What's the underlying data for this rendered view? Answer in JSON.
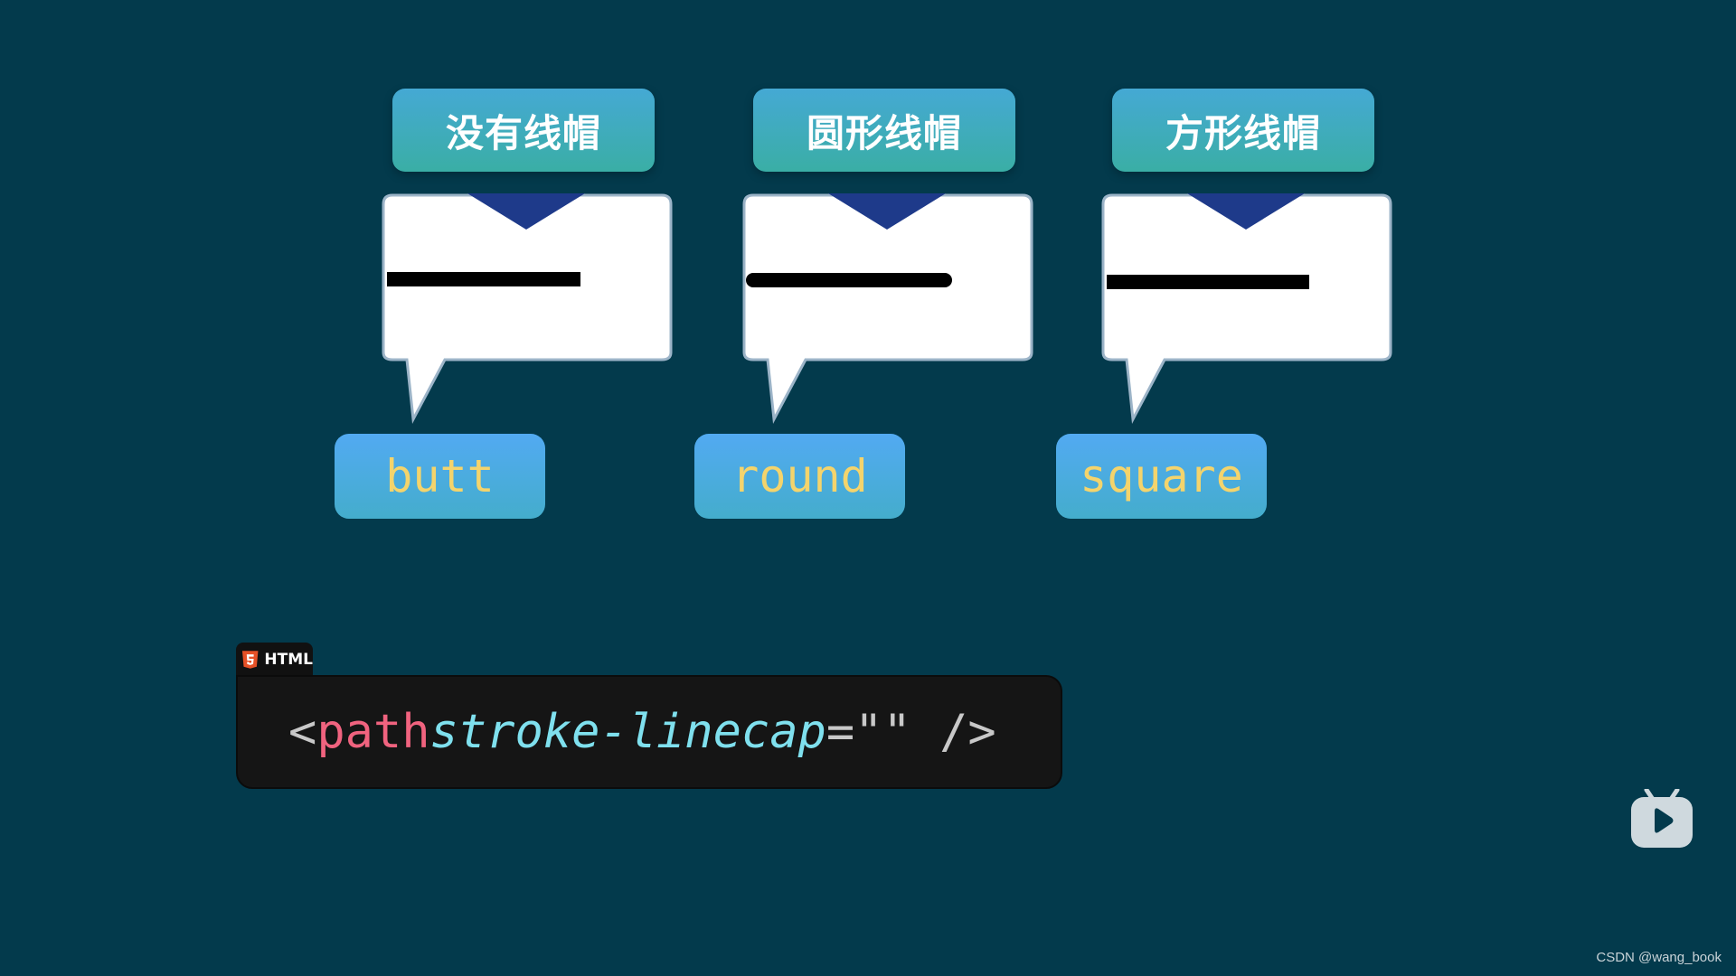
{
  "cards": [
    {
      "title": "没有线帽",
      "value": "butt",
      "linecap": "butt"
    },
    {
      "title": "圆形线帽",
      "value": "round",
      "linecap": "round"
    },
    {
      "title": "方形线帽",
      "value": "square",
      "linecap": "square"
    }
  ],
  "code": {
    "language_tab": "HTML",
    "open": "<",
    "tag": "path",
    "attr": "stroke-linecap",
    "eq": "=\"\"",
    "close": " />"
  },
  "icons": {
    "html5": "html5-icon",
    "player": "tv-play-icon"
  },
  "watermark": "CSDN @wang_book",
  "colors": {
    "background": "#033a4c",
    "label_top": "#45a9d4",
    "label_bottom": "#3aaea5",
    "arrow": "#1e3a8a",
    "value_text": "#f4d46c",
    "code_tag": "#f0637f",
    "code_attr": "#7fe0ee"
  }
}
